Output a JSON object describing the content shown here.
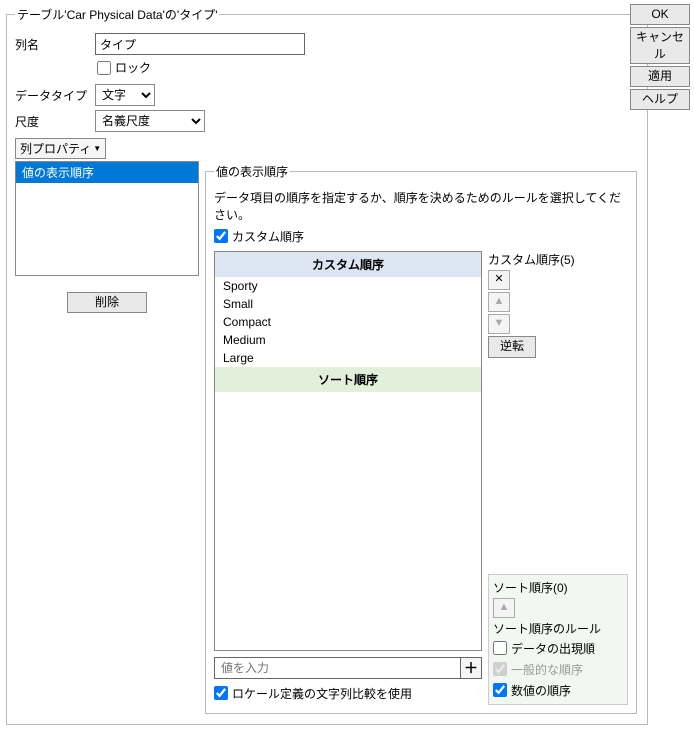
{
  "groupbox_title": "テーブル'Car Physical Data'の'タイプ'",
  "buttons": {
    "ok": "OK",
    "cancel": "キャンセル",
    "apply": "適用",
    "help": "ヘルプ"
  },
  "fields": {
    "colname_label": "列名",
    "colname_value": "タイプ",
    "lock_label": "ロック",
    "datatype_label": "データタイプ",
    "datatype_value": "文字",
    "scale_label": "尺度",
    "scale_value": "名義尺度"
  },
  "prop_dropdown": "列プロパティ",
  "listbox_item": "値の表示順序",
  "delete_btn": "削除",
  "value_order": {
    "legend": "値の表示順序",
    "instruction": "データ項目の順序を指定するか、順序を決めるためのルールを選択してください。",
    "custom_checkbox": "カスタム順序",
    "custom_header": "カスタム順序",
    "sort_header": "ソート順序",
    "items": [
      "Sporty",
      "Small",
      "Compact",
      "Medium",
      "Large"
    ],
    "side_custom_label": "カスタム順序(5)",
    "reverse_btn": "逆転",
    "side_sort_label": "ソート順序(0)",
    "rules_label": "ソート順序のルール",
    "rule_occurrence": "データの出現順",
    "rule_general": "一般的な順序",
    "rule_numeric": "数値の順序",
    "input_placeholder": "値を入力",
    "locale_checkbox": "ロケール定義の文字列比較を使用"
  }
}
